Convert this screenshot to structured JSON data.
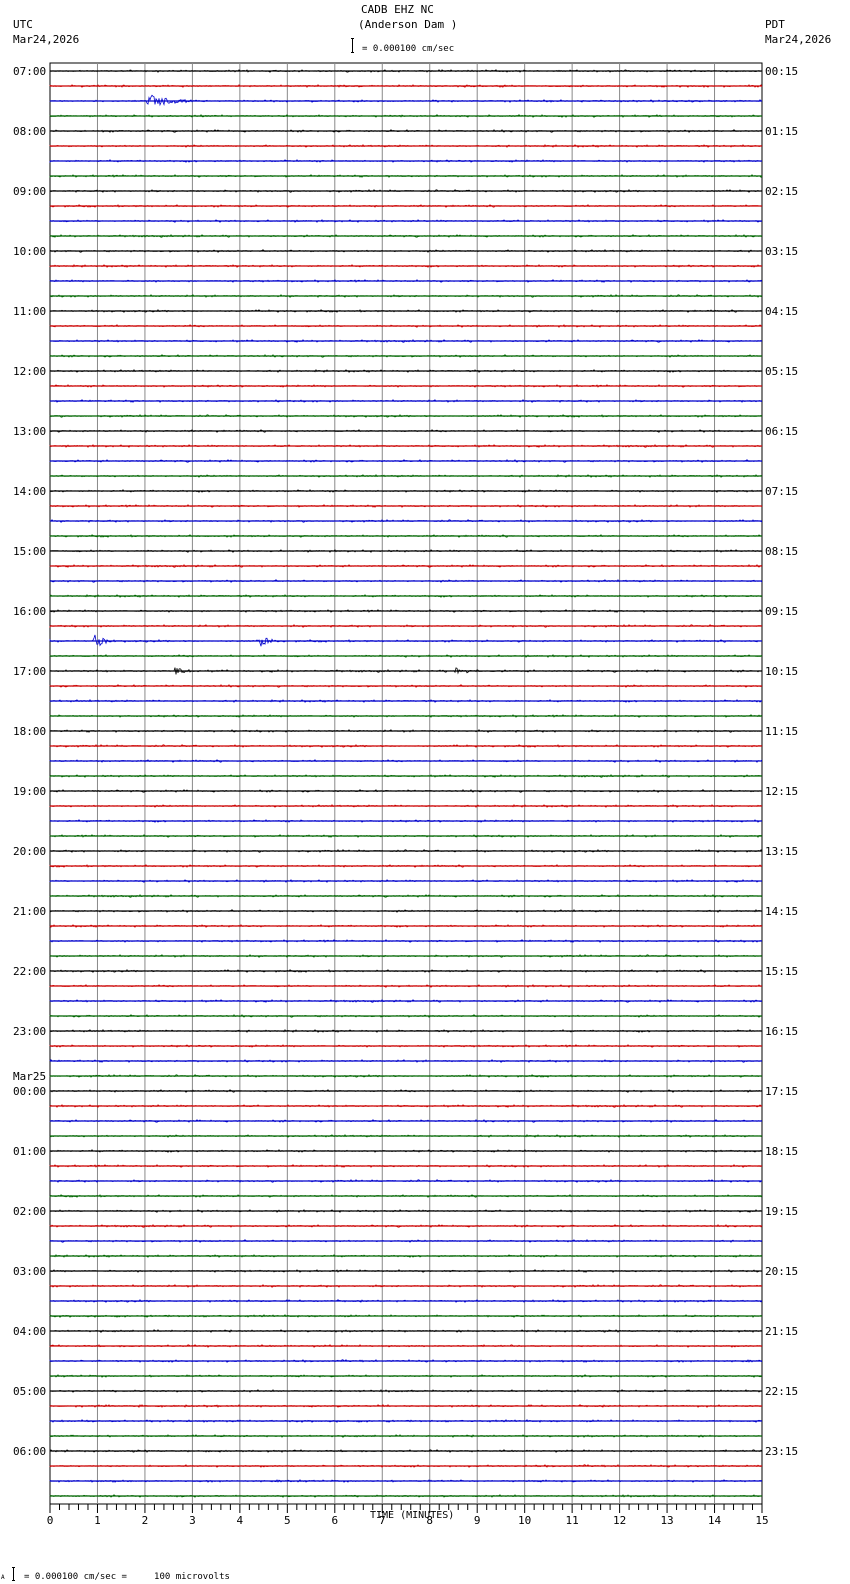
{
  "header": {
    "title": "CADB EHZ NC",
    "subtitle": "(Anderson Dam )",
    "scale_label": "= 0.000100 cm/sec",
    "left_tz": "UTC",
    "left_date": "Mar24,2026",
    "right_tz": "PDT",
    "right_date": "Mar24,2026"
  },
  "footer": {
    "scale_prefix": "A",
    "scale_text": "= 0.000100 cm/sec =     100 microvolts"
  },
  "chart_data": {
    "type": "line",
    "title": "CADB EHZ NC (Anderson Dam )",
    "xlabel": "TIME (MINUTES)",
    "xlim": [
      0,
      15
    ],
    "x_ticks": [
      "0",
      "1",
      "2",
      "3",
      "4",
      "5",
      "6",
      "7",
      "8",
      "9",
      "10",
      "11",
      "12",
      "13",
      "14",
      "15"
    ],
    "minutes_per_trace": 15,
    "trace_colors": [
      "#000000",
      "#cc0000",
      "#0000cc",
      "#006600"
    ],
    "left_labels": [
      "07:00",
      "08:00",
      "09:00",
      "10:00",
      "11:00",
      "12:00",
      "13:00",
      "14:00",
      "15:00",
      "16:00",
      "17:00",
      "18:00",
      "19:00",
      "20:00",
      "21:00",
      "22:00",
      "23:00",
      "00:00",
      "01:00",
      "02:00",
      "03:00",
      "04:00",
      "05:00",
      "06:00"
    ],
    "date_change_label": "Mar25",
    "right_labels": [
      "00:15",
      "01:15",
      "02:15",
      "03:15",
      "04:15",
      "05:15",
      "06:15",
      "07:15",
      "08:15",
      "09:15",
      "10:15",
      "11:15",
      "12:15",
      "13:15",
      "14:15",
      "15:15",
      "16:15",
      "17:15",
      "18:15",
      "19:15",
      "20:15",
      "21:15",
      "22:15",
      "23:15"
    ],
    "events": [
      {
        "utc": "07:30",
        "trace": 2,
        "minute": 2.0,
        "duration": 1.5,
        "amplitude": 8
      },
      {
        "utc": "16:30",
        "trace": 38,
        "minute": 0.9,
        "duration": 0.5,
        "amplitude": 11
      },
      {
        "utc": "16:30",
        "trace": 38,
        "minute": 4.4,
        "duration": 0.5,
        "amplitude": 9
      },
      {
        "utc": "17:00",
        "trace": 40,
        "minute": 2.6,
        "duration": 0.6,
        "amplitude": 6
      },
      {
        "utc": "17:00",
        "trace": 40,
        "minute": 8.5,
        "duration": 0.8,
        "amplitude": 5
      },
      {
        "utc": "03:30",
        "trace": 82,
        "minute": 2.35,
        "duration": 0.15,
        "amplitude": 4
      }
    ]
  }
}
